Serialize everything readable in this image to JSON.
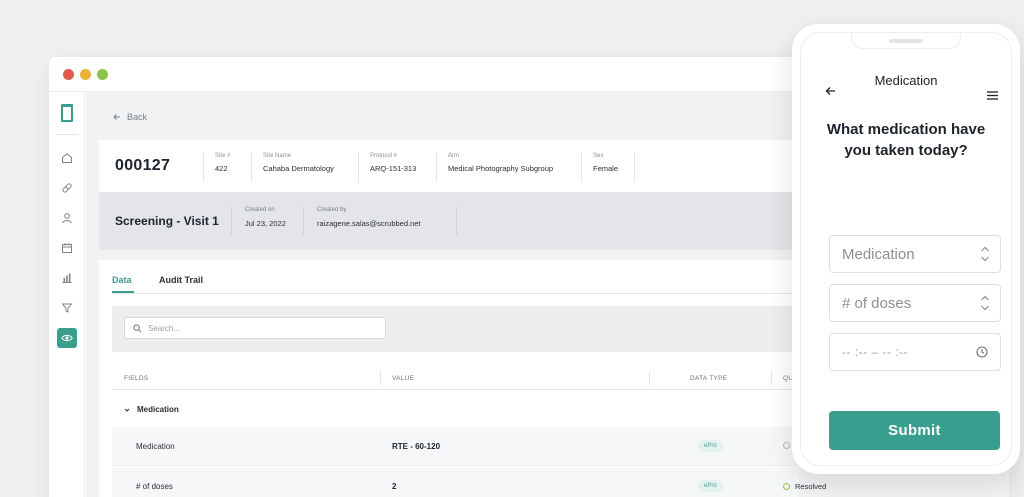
{
  "nav": {
    "back_label": "Back",
    "icons": [
      "home-icon",
      "pill-icon",
      "user-icon",
      "calendar-icon",
      "chart-icon",
      "filter-icon",
      "eye-icon"
    ]
  },
  "subject": {
    "id": "000127",
    "meta": [
      {
        "label": "Site #",
        "value": "422"
      },
      {
        "label": "Site Name",
        "value": "Cahaba Dermatology"
      },
      {
        "label": "Protocol #",
        "value": "ARQ-151-313"
      },
      {
        "label": "Arm",
        "value": "Medical Photography Subgroup"
      },
      {
        "label": "Sex",
        "value": "Female"
      }
    ]
  },
  "visit": {
    "title": "Screening - Visit 1",
    "created_on_label": "Created on",
    "created_on": "Jul 23, 2022",
    "created_by_label": "Created by",
    "created_by": "raizagene.salas@scrubbed.net"
  },
  "tabs": [
    "Data",
    "Audit Trail"
  ],
  "search": {
    "placeholder": "Search..."
  },
  "table": {
    "headers": [
      "FIELDS",
      "VALUE",
      "DATA TYPE",
      "QU"
    ],
    "group": "Medication",
    "rows": [
      {
        "field": "Medication",
        "value": "RTE - 60-120",
        "type": "ePro",
        "status": ""
      },
      {
        "field": "# of doses",
        "value": "2",
        "type": "ePro",
        "status": "Resolved"
      }
    ]
  },
  "phone": {
    "title": "Medication",
    "question": "What medication have you taken today?",
    "medication_placeholder": "Medication",
    "doses_placeholder": "# of doses",
    "time_placeholder": "-- :--  –  -- :--",
    "submit_label": "Submit"
  },
  "colors": {
    "accent": "#3a9e8f",
    "resolved": "#8fc54a"
  }
}
